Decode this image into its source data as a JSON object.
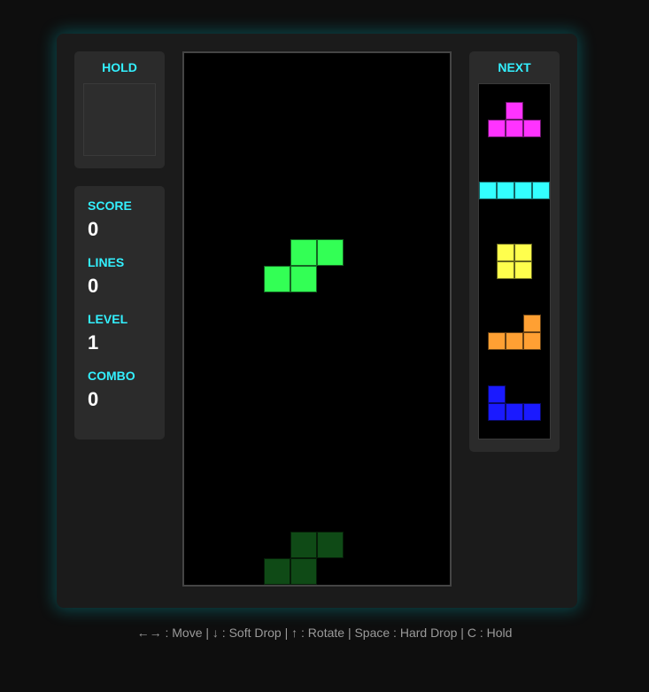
{
  "hold": {
    "title": "HOLD"
  },
  "stats": [
    {
      "label": "SCORE",
      "value": "0"
    },
    {
      "label": "LINES",
      "value": "0"
    },
    {
      "label": "LEVEL",
      "value": "1"
    },
    {
      "label": "COMBO",
      "value": "0"
    }
  ],
  "next": {
    "title": "NEXT",
    "queue": [
      {
        "piece": "T",
        "color": "#ff33ff"
      },
      {
        "piece": "I",
        "color": "#33ffff"
      },
      {
        "piece": "O",
        "color": "#ffff4d"
      },
      {
        "piece": "L",
        "color": "#ffa033"
      },
      {
        "piece": "J",
        "color": "#1a1aff"
      }
    ]
  },
  "board": {
    "columns": 10,
    "rows": 20,
    "active_piece": {
      "piece": "S",
      "color": "#33ff55",
      "cells": [
        [
          4,
          7
        ],
        [
          5,
          7
        ],
        [
          3,
          8
        ],
        [
          4,
          8
        ]
      ]
    },
    "ghost_piece": {
      "piece": "S",
      "color": "#0f4a16",
      "cells": [
        [
          4,
          18
        ],
        [
          5,
          18
        ],
        [
          3,
          19
        ],
        [
          4,
          19
        ]
      ]
    }
  },
  "controls": "←→ : Move | ↓ : Soft Drop | ↑ : Rotate | Space : Hard Drop | C : Hold"
}
